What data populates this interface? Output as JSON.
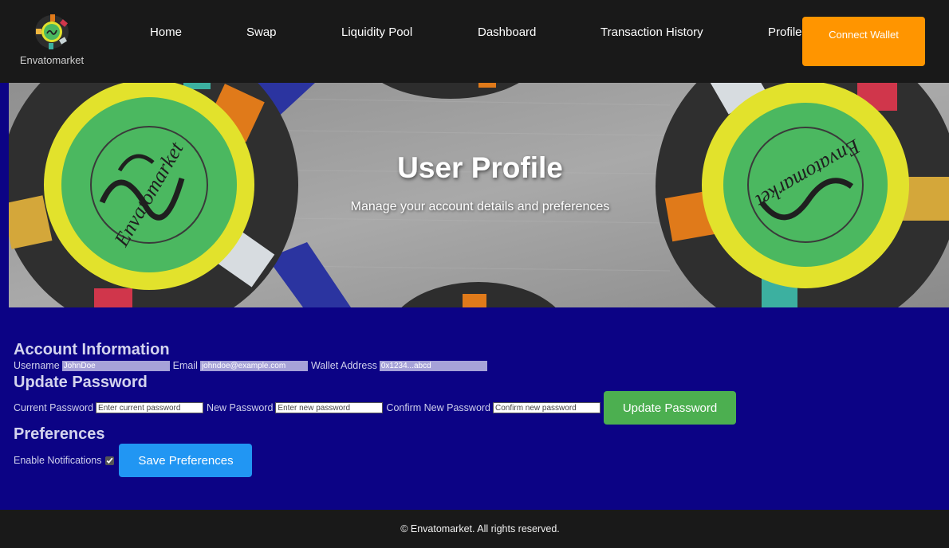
{
  "brand": {
    "name": "Envatomarket",
    "logo_icon": "coin-logo-icon"
  },
  "nav": {
    "items": [
      {
        "label": "Home"
      },
      {
        "label": "Swap"
      },
      {
        "label": "Liquidity Pool"
      },
      {
        "label": "Dashboard"
      },
      {
        "label": "Transaction History"
      },
      {
        "label": "Profile"
      }
    ],
    "connect_label": "Connect Wallet"
  },
  "hero": {
    "title": "User Profile",
    "subtitle": "Manage your account details and preferences",
    "coin_text": "Envatomarket"
  },
  "account": {
    "title": "Account Information",
    "username_label": "Username",
    "username_value": "JohnDoe",
    "email_label": "Email",
    "email_value": "johndoe@example.com",
    "wallet_label": "Wallet Address",
    "wallet_value": "0x1234...abcd"
  },
  "password": {
    "title": "Update Password",
    "current_label": "Current Password",
    "current_placeholder": "Enter current password",
    "new_label": "New Password",
    "new_placeholder": "Enter new password",
    "confirm_label": "Confirm New Password",
    "confirm_placeholder": "Confirm new password",
    "button_label": "Update Password"
  },
  "preferences": {
    "title": "Preferences",
    "notifications_label": "Enable Notifications",
    "notifications_checked": true,
    "button_label": "Save Preferences"
  },
  "footer": {
    "text": "© Envatomarket. All rights reserved."
  },
  "colors": {
    "header_bg": "#191919",
    "main_bg": "#0c0385",
    "connect_button": "#ff9500",
    "update_button": "#4caf50",
    "save_button": "#2196f3",
    "coin_green": "#4bb860",
    "coin_yellow": "#e2e22c"
  }
}
